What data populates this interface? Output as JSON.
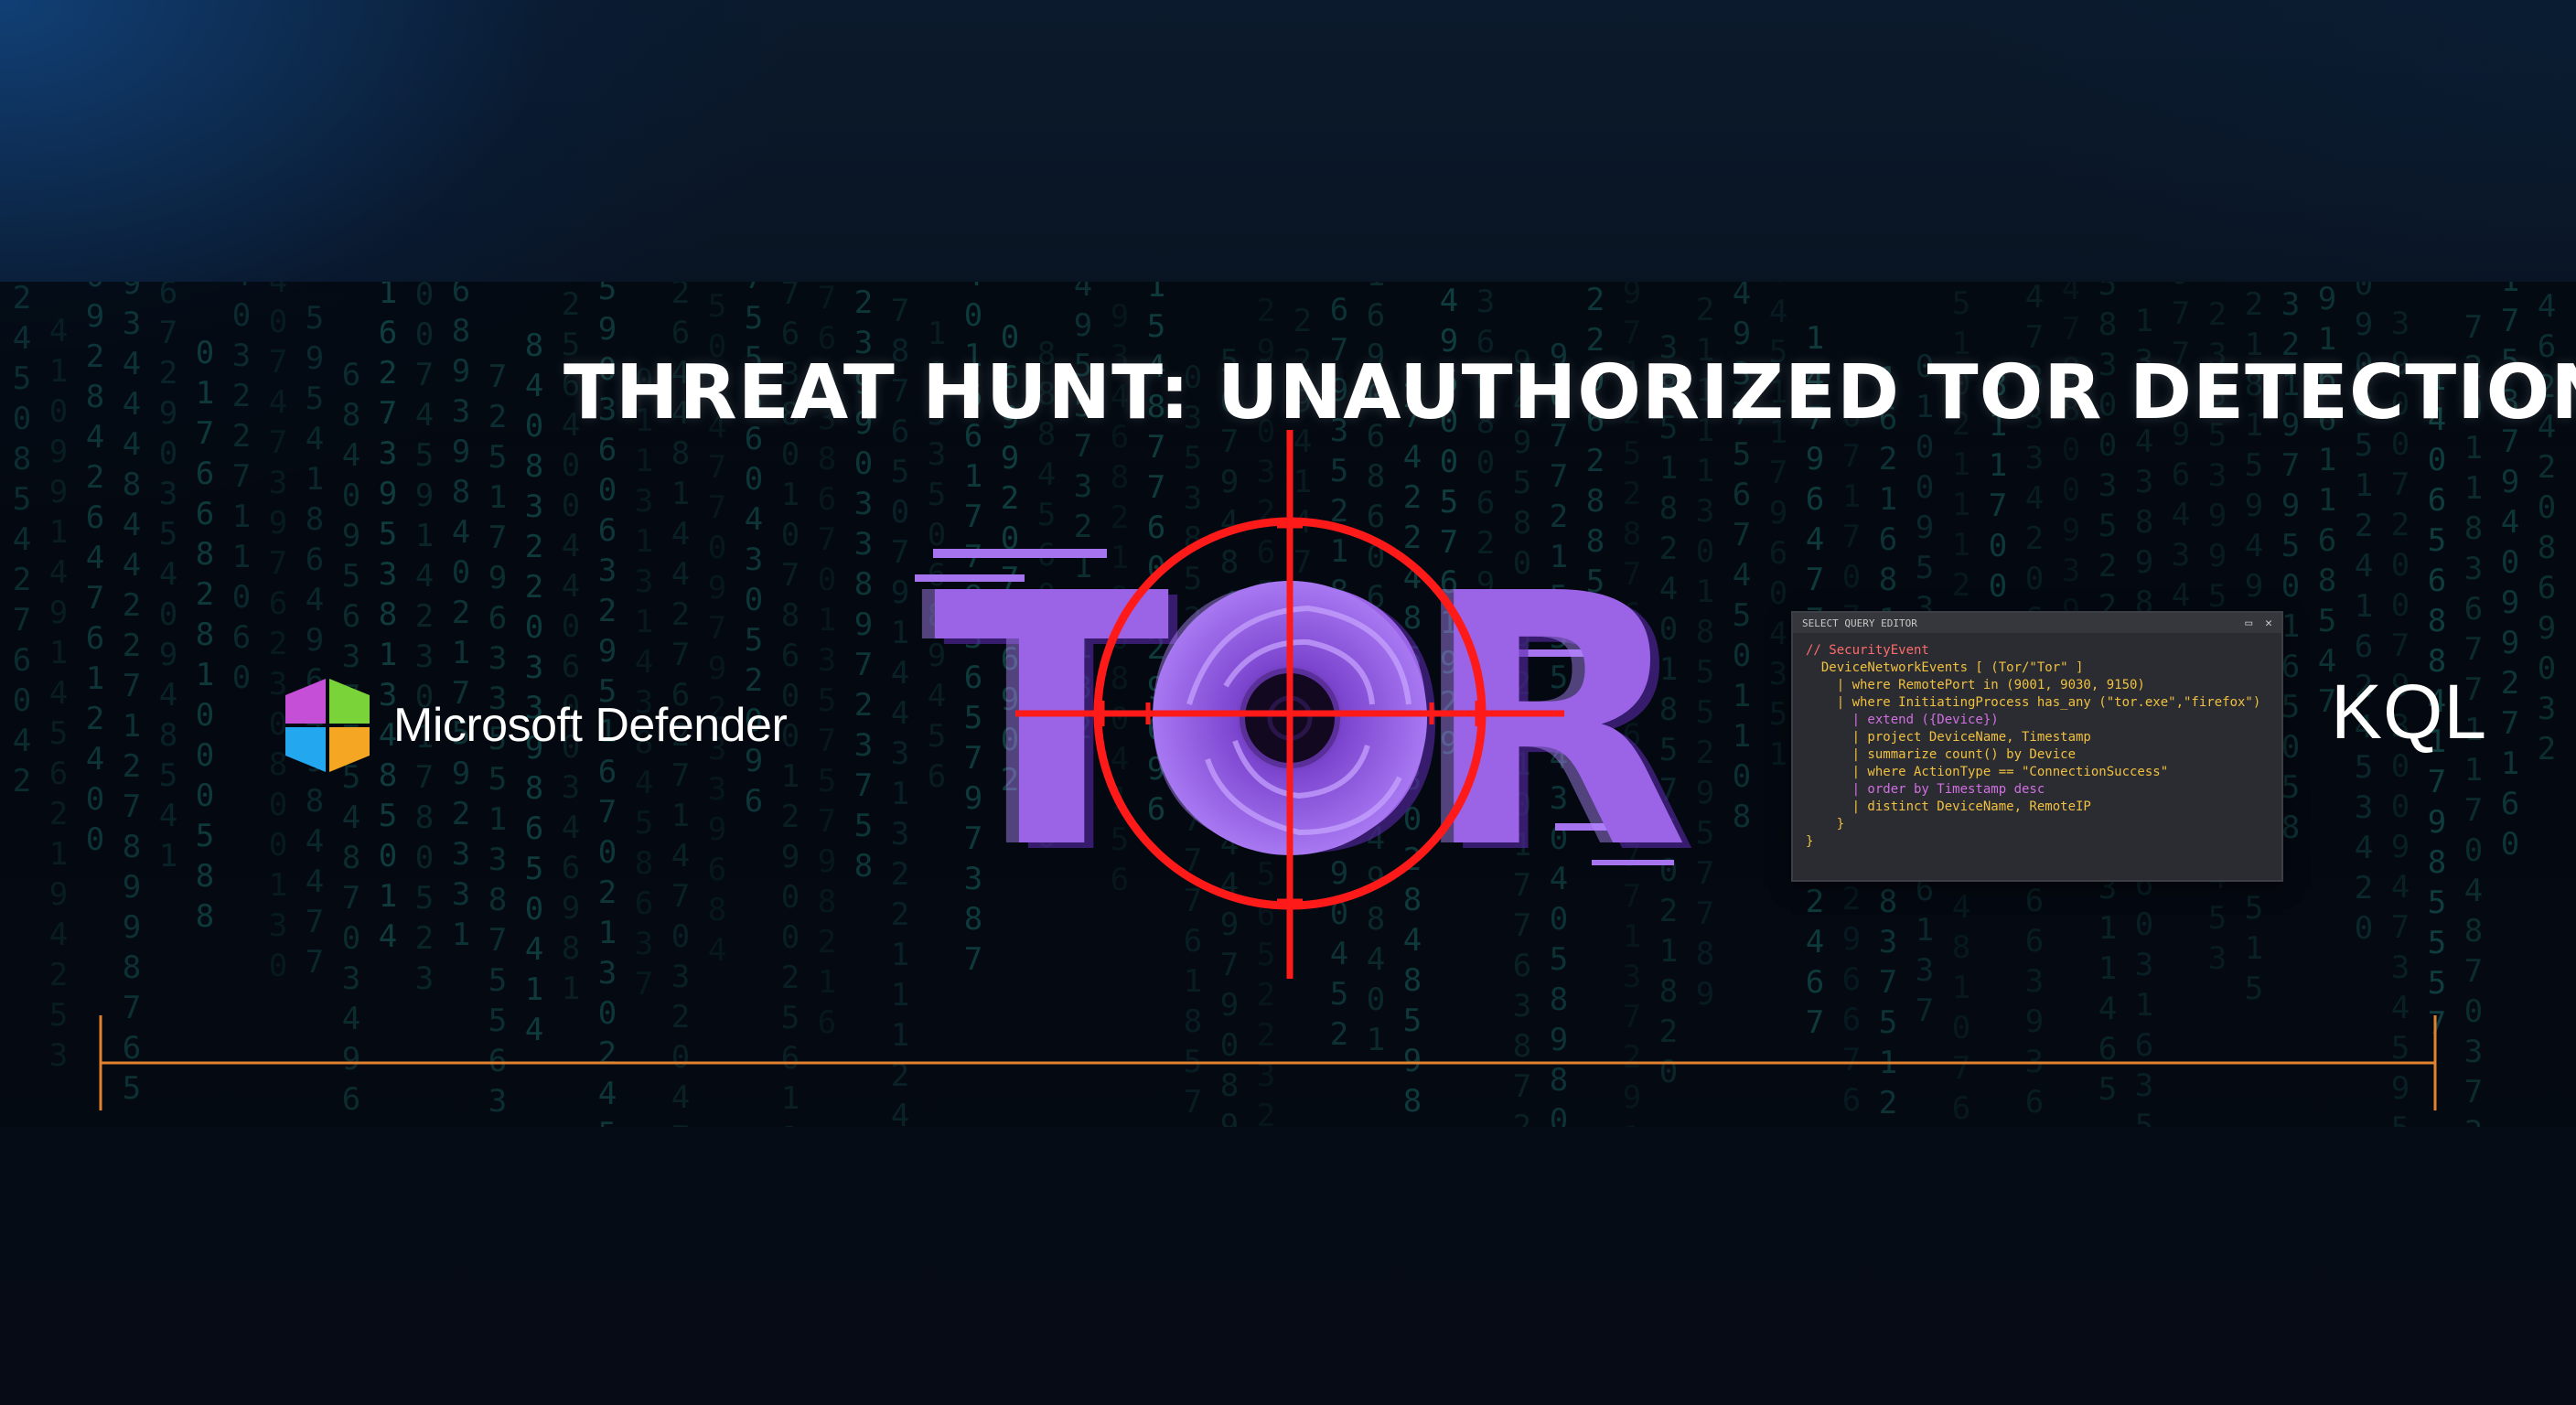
{
  "title": "THREAT HUNT: UNAUTHORIZED TOR DETECTION",
  "defender": {
    "label": "Microsoft Defender",
    "logo_colors": [
      "#c64fd8",
      "#7bd33a",
      "#23a7ee",
      "#f5a623"
    ]
  },
  "tor_logo": {
    "text": "TOR",
    "color": "#9b63e6",
    "crosshair_color": "#ff1a1a"
  },
  "code_panel": {
    "header": "SELECT QUERY EDITOR",
    "lines": [
      {
        "text": "// SecurityEvent",
        "color": "#ff6b6b"
      },
      {
        "text": "  DeviceNetworkEvents [ (Tor/\"Tor\" ]",
        "color": "#f0c040"
      },
      {
        "text": "    | where RemotePort in (9001, 9030, 9150)",
        "color": "#f0c040"
      },
      {
        "text": "    | where InitiatingProcess has_any (\"tor.exe\",\"firefox\")",
        "color": "#f0c040"
      },
      {
        "text": "      | extend ({Device})",
        "color": "#d070e0"
      },
      {
        "text": "      | project DeviceName, Timestamp",
        "color": "#f0c040"
      },
      {
        "text": "      | summarize count() by Device",
        "color": "#f0c040"
      },
      {
        "text": "      | where ActionType == \"ConnectionSuccess\"",
        "color": "#f0c040"
      },
      {
        "text": "      | order by Timestamp desc",
        "color": "#d070e0"
      },
      {
        "text": "      | distinct DeviceName, RemoteIP",
        "color": "#f0c040"
      },
      {
        "text": "    }",
        "color": "#f0c040"
      },
      {
        "text": "}",
        "color": "#f0c040"
      }
    ]
  },
  "kql_label": "KQL",
  "timeline_color": "#e0822e"
}
